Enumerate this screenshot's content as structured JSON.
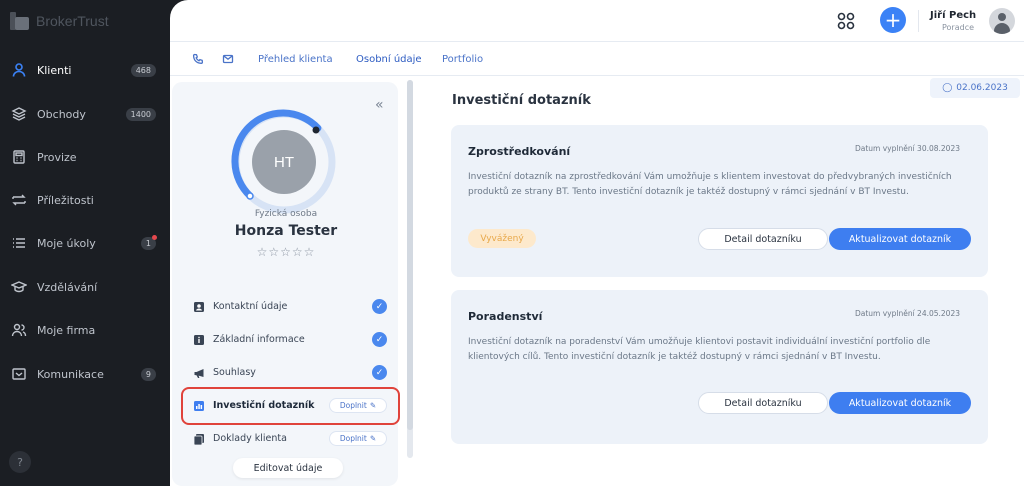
{
  "app": {
    "brand": "BrokerTrust",
    "help": "?"
  },
  "sidebar": {
    "items": [
      {
        "label": "Klienti",
        "badge": "468",
        "icon": "user-icon",
        "active": true
      },
      {
        "label": "Obchody",
        "badge": "1400",
        "icon": "layers-icon"
      },
      {
        "label": "Provize",
        "badge": "",
        "icon": "calculator-icon"
      },
      {
        "label": "Příležitosti",
        "badge": "",
        "icon": "transfer-icon"
      },
      {
        "label": "Moje úkoly",
        "badge": "1",
        "icon": "list-icon",
        "notify": true
      },
      {
        "label": "Vzdělávání",
        "badge": "",
        "icon": "graduation-cap-icon"
      },
      {
        "label": "Moje firma",
        "badge": "",
        "icon": "users-icon"
      },
      {
        "label": "Komunikace",
        "badge": "9",
        "icon": "chat-icon"
      }
    ]
  },
  "header": {
    "user_name": "Jiří Pech",
    "user_role": "Poradce",
    "add": "+"
  },
  "tabs": {
    "overview": "Přehled klienta",
    "personal": "Osobní údaje",
    "portfolio": "Portfolio"
  },
  "date_chip": "02.06.2023",
  "profile": {
    "initials": "HT",
    "type": "Fyzická osoba",
    "name": "Honza Tester",
    "stars": "☆☆☆☆☆",
    "collapse": "«",
    "edit_button": "Editovat údaje",
    "items": [
      {
        "label": "Kontaktní údaje",
        "status": "done"
      },
      {
        "label": "Základní informace",
        "status": "done"
      },
      {
        "label": "Souhlasy",
        "status": "done"
      },
      {
        "label": "Investiční dotazník",
        "status": "todo",
        "action": "Doplnit"
      },
      {
        "label": "Doklady klienta",
        "status": "todo",
        "action": "Doplnit"
      }
    ]
  },
  "content": {
    "title": "Investiční dotazník",
    "cards": [
      {
        "title": "Zprostředkování",
        "date": "Datum vyplnění 30.08.2023",
        "text": "Investiční dotazník na zprostředkování Vám umožňuje s klientem investovat do předvybraných investičních produktů ze strany BT. Tento investiční dotazník je taktéž dostupný v rámci sjednání v BT Investu.",
        "badge": "Vyvážený",
        "detail_button": "Detail dotazníku",
        "update_button": "Aktualizovat dotazník"
      },
      {
        "title": "Poradenství",
        "date": "Datum vyplnění 24.05.2023",
        "text": "Investiční dotazník na poradenství Vám umožňuje klientovi postavit individuální investiční portfolio dle klientových cílů. Tento investiční dotazník je taktéž dostupný v rámci sjednání v BT Investu.",
        "detail_button": "Detail dotazníku",
        "update_button": "Aktualizovat dotazník"
      }
    ]
  },
  "colors": {
    "accent": "#3e7ef0",
    "sidebar_bg": "#1b1e23",
    "highlight": "#e0433b",
    "balanced": "#e8a84a"
  }
}
